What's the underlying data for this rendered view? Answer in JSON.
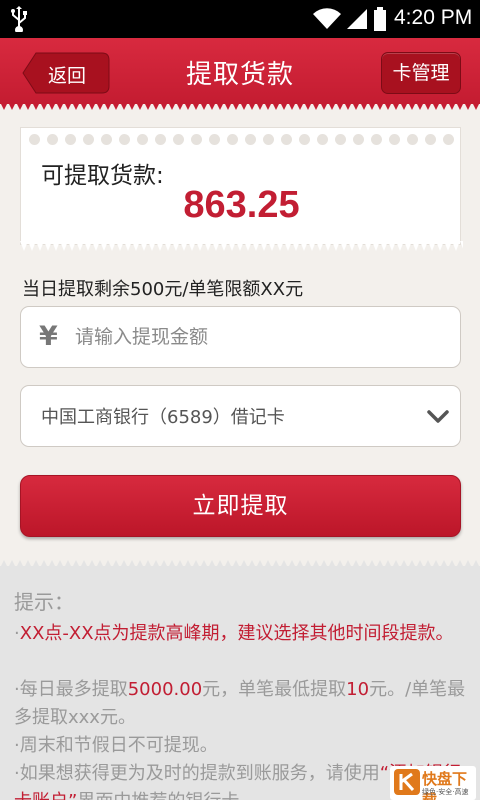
{
  "status_bar": {
    "time": "4:20 PM"
  },
  "header": {
    "back_label": "返回",
    "title": "提取货款",
    "card_manage_label": "卡管理"
  },
  "balance": {
    "label": "可提取货款:",
    "amount": "863.25"
  },
  "limit_text": "当日提取剩余500元/单笔限额XX元",
  "amount_input": {
    "currency_symbol": "¥",
    "placeholder": "请输入提现金额",
    "value": ""
  },
  "bank_select": {
    "selected": "中国工商银行（6589）借记卡"
  },
  "submit_label": "立即提取",
  "tips": {
    "heading": "提示：",
    "items": [
      {
        "text": "XX点-XX点为提款高峰期，建议选择其他时间段提款。"
      },
      {
        "pre": "每日最多提取",
        "highlight1": "5000.00",
        "mid": "元，单笔最低提取",
        "highlight2": "10",
        "post": "元。/单笔最多提取xxx元。"
      },
      {
        "text": "周末和节假日不可提现。"
      },
      {
        "pre": "如果想获得更为及时的提款到账服务，请使用",
        "highlight": "“添加银行卡账户”",
        "post": "界面中推荐的银行卡"
      }
    ]
  },
  "watermark": {
    "title": "快盘下载",
    "subtitle": "绿色·安全·高速"
  },
  "colors": {
    "brand_red": "#c41c31",
    "tip_gray": "#9a9a9a",
    "background": "#f3f0ec"
  },
  "icons": [
    "usb-icon",
    "wifi-icon",
    "signal-icon",
    "battery-icon",
    "yen-icon",
    "chevron-down-icon"
  ]
}
